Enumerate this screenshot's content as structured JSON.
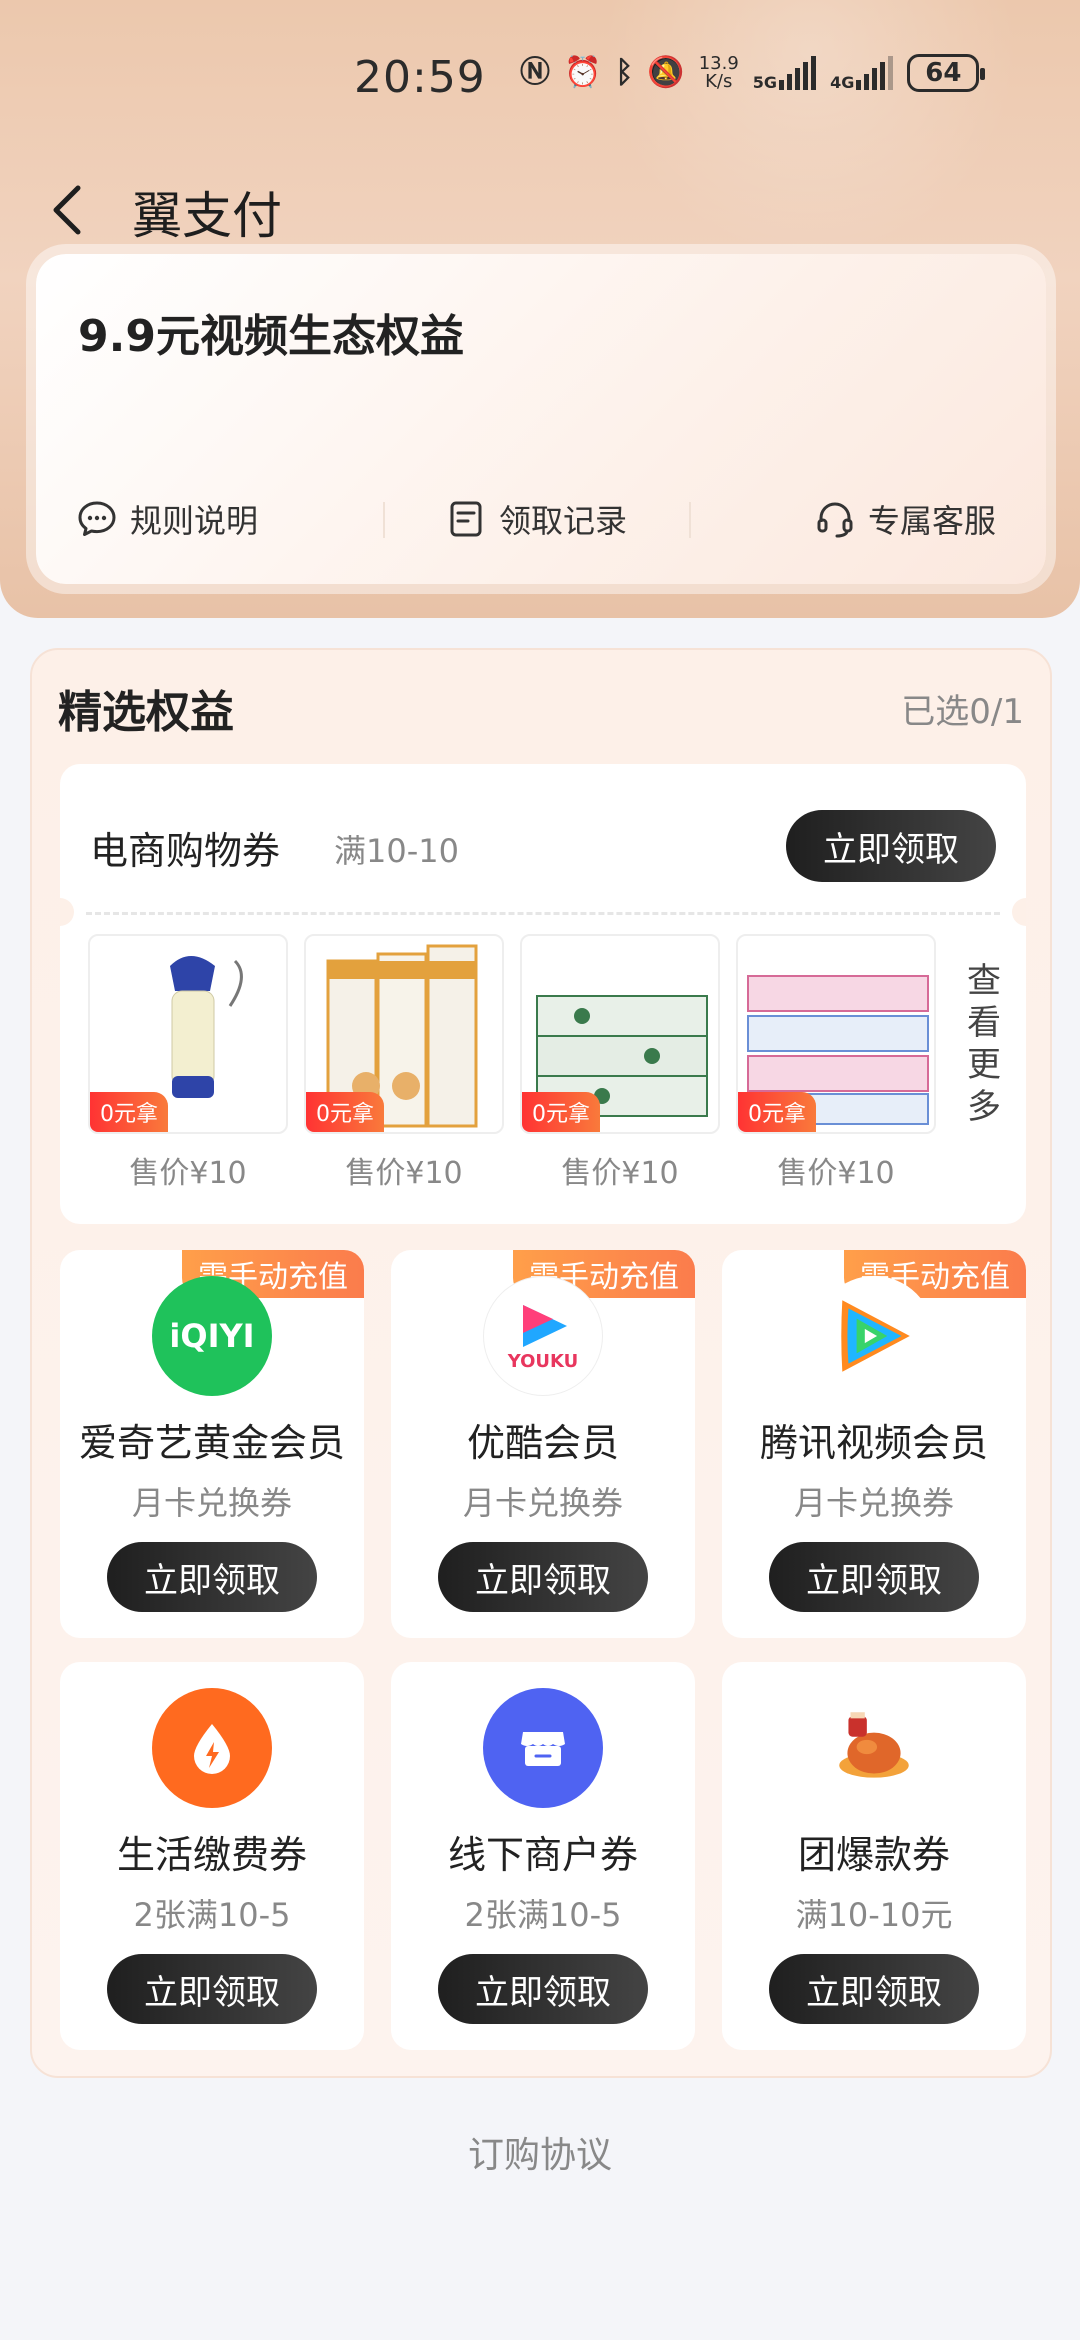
{
  "status": {
    "time": "20:59",
    "speed_top": "13.9",
    "speed_bottom": "K/s",
    "net1": "5G",
    "net2": "4G",
    "battery": "64"
  },
  "header": {
    "title": "翼支付"
  },
  "banner": {
    "title": "9.9元视频生态权益",
    "links": [
      {
        "label": "规则说明",
        "icon": "message-icon"
      },
      {
        "label": "领取记录",
        "icon": "record-icon"
      },
      {
        "label": "专属客服",
        "icon": "headset-icon"
      }
    ]
  },
  "section": {
    "title": "精选权益",
    "selected": "已选0/1"
  },
  "shopping": {
    "name": "电商购物券",
    "condition": "满10-10",
    "button": "立即领取",
    "products": [
      {
        "tag": "0元拿",
        "price": "售价¥10"
      },
      {
        "tag": "0元拿",
        "price": "售价¥10"
      },
      {
        "tag": "0元拿",
        "price": "售价¥10"
      },
      {
        "tag": "0元拿",
        "price": "售价¥10"
      }
    ],
    "more": "查看更多"
  },
  "tiles": [
    {
      "badge": "需手动充值",
      "logo_text": "iQIYI",
      "name": "爱奇艺黄金会员",
      "sub": "月卡兑换券",
      "button": "立即领取"
    },
    {
      "badge": "需手动充值",
      "logo_text": "YOUKU",
      "name": "优酷会员",
      "sub": "月卡兑换券",
      "button": "立即领取"
    },
    {
      "badge": "需手动充值",
      "logo_text": "",
      "name": "腾讯视频会员",
      "sub": "月卡兑换券",
      "button": "立即领取"
    },
    {
      "badge": "",
      "logo_text": "",
      "name": "生活缴费券",
      "sub": "2张满10-5",
      "button": "立即领取"
    },
    {
      "badge": "",
      "logo_text": "",
      "name": "线下商户券",
      "sub": "2张满10-5",
      "button": "立即领取"
    },
    {
      "badge": "",
      "logo_text": "",
      "name": "团爆款券",
      "sub": "满10-10元",
      "button": "立即领取"
    }
  ],
  "footer": {
    "link": "订购协议"
  }
}
